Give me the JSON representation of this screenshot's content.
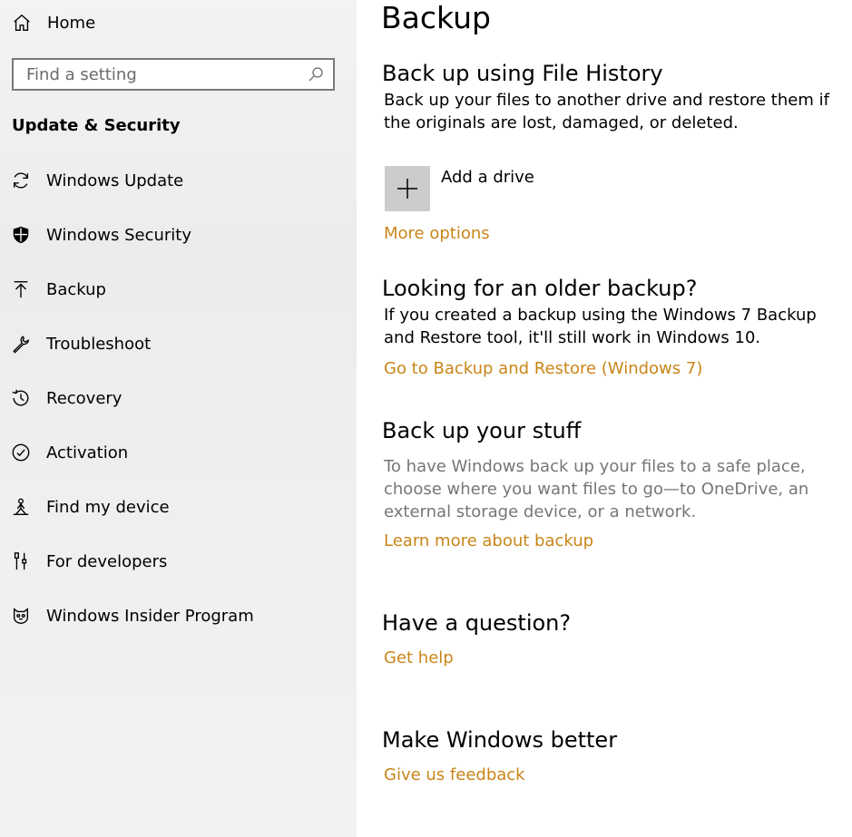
{
  "sidebar": {
    "home_label": "Home",
    "search_placeholder": "Find a setting",
    "section_title": "Update & Security",
    "items": [
      {
        "label": "Windows Update",
        "icon": "sync-icon"
      },
      {
        "label": "Windows Security",
        "icon": "shield-icon"
      },
      {
        "label": "Backup",
        "icon": "upload-arrow-icon"
      },
      {
        "label": "Troubleshoot",
        "icon": "wrench-icon"
      },
      {
        "label": "Recovery",
        "icon": "history-icon"
      },
      {
        "label": "Activation",
        "icon": "check-circle-icon"
      },
      {
        "label": "Find my device",
        "icon": "person-location-icon"
      },
      {
        "label": "For developers",
        "icon": "developer-tools-icon"
      },
      {
        "label": "Windows Insider Program",
        "icon": "insider-cat-icon"
      }
    ]
  },
  "main": {
    "title": "Backup",
    "file_history": {
      "heading": "Back up using File History",
      "description": "Back up your files to another drive and restore them if the originals are lost, damaged, or deleted.",
      "add_drive_label": "Add a drive",
      "more_options": "More options"
    },
    "older_backup": {
      "heading": "Looking for an older backup?",
      "description": "If you created a backup using the Windows 7 Backup and Restore tool, it'll still work in Windows 10.",
      "link": "Go to Backup and Restore (Windows 7)"
    },
    "your_stuff": {
      "heading": "Back up your stuff",
      "description": "To have Windows back up your files to a safe place, choose where you want files to go—to OneDrive, an external storage device, or a network.",
      "link": "Learn more about backup"
    },
    "question": {
      "heading": "Have a question?",
      "link": "Get help"
    },
    "better": {
      "heading": "Make Windows better",
      "link": "Give us feedback"
    }
  },
  "colors": {
    "accent_link": "#c98518",
    "sidebar_bg": "#efefef",
    "add_drive_bg": "#cccccc",
    "muted_text": "#767676"
  }
}
